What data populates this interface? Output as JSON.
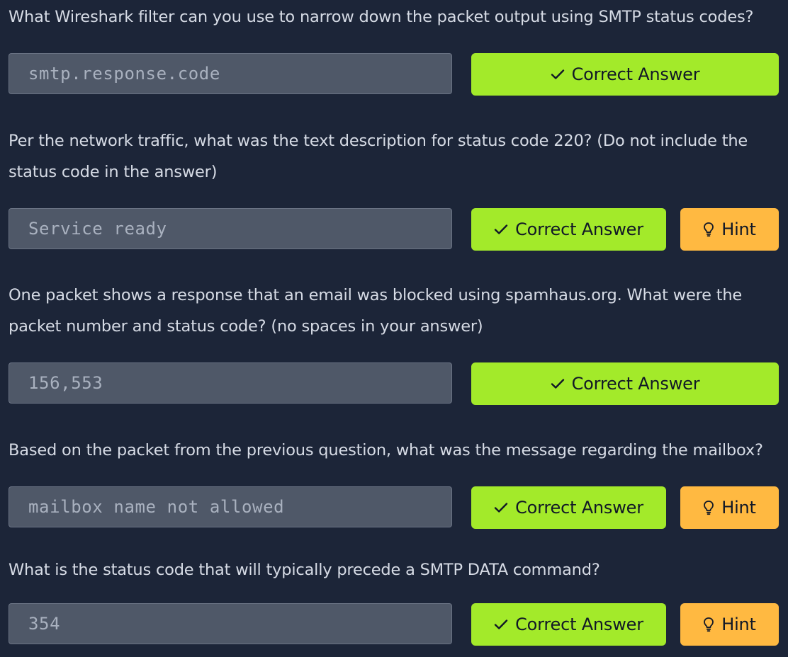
{
  "questions": [
    {
      "text": "What Wireshark filter can you use to narrow down the packet output using SMTP status codes?",
      "answer": "smtp.response.code",
      "correct_label": "Correct Answer",
      "has_hint": false
    },
    {
      "text": "Per the network traffic, what was the text description for status code 220? (Do not include the status code in the answer)",
      "answer": "Service ready",
      "correct_label": "Correct Answer",
      "has_hint": true,
      "hint_label": "Hint"
    },
    {
      "text": "One packet shows a response that an email was blocked using spamhaus.org. What were the packet number and status code? (no spaces in your answer)",
      "answer": "156,553",
      "correct_label": "Correct Answer",
      "has_hint": false
    },
    {
      "text": "Based on the packet from the previous question, what was the message regarding the mailbox?",
      "answer": "mailbox name not allowed",
      "correct_label": "Correct Answer",
      "has_hint": true,
      "hint_label": "Hint"
    },
    {
      "text": "What is the status code that will typically precede a SMTP DATA command?",
      "answer": "354",
      "correct_label": "Correct Answer",
      "has_hint": true,
      "hint_label": "Hint"
    }
  ],
  "icons": {
    "check": "check-icon",
    "hint": "lightbulb-icon"
  },
  "colors": {
    "background": "#1c2538",
    "correct": "#a3ea2a",
    "hint": "#ffb941",
    "input_bg": "#4f5868"
  }
}
